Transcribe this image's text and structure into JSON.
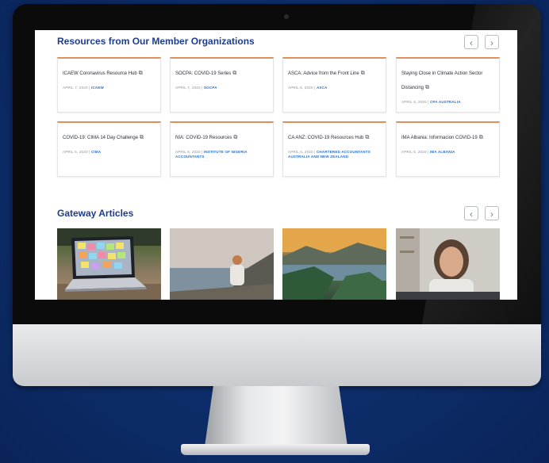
{
  "resources": {
    "title": "Resources from Our Member Organizations",
    "prev_label": "‹",
    "next_label": "›",
    "cards": [
      {
        "title": "ICAEW Coronavirus Resource Hub",
        "date": "APRIL 7, 2020",
        "org": "ICAEW"
      },
      {
        "title": "SOCPA: COVID-19 Series",
        "date": "APRIL 7, 2020",
        "org": "SOCPA"
      },
      {
        "title": "ASCA: Advice from the Front Line",
        "date": "APRIL 6, 2020",
        "org": "ASCA"
      },
      {
        "title": "Staying Close in Climate Action Sector Distancing",
        "date": "APRIL 6, 2020",
        "org": "CPA AUSTRALIA"
      },
      {
        "title": "COVID-19: CIMA 14 Day Challenge",
        "date": "APRIL 6, 2020",
        "org": "CIMA"
      },
      {
        "title": "NIA: COVID-19 Resources",
        "date": "APRIL 6, 2020",
        "org": "INSTITUTE OF NIGERIA ACCOUNTANTS"
      },
      {
        "title": "CA ANZ: COVID-19 Resources Hub",
        "date": "APRIL 6, 2020",
        "org": "CHARTERED ACCOUNTANTS AUSTRALIA AND NEW ZEALAND"
      },
      {
        "title": "IMA Albania: Informacion COVID-19",
        "date": "APRIL 6, 2020",
        "org": "IMA ALBANIA"
      }
    ]
  },
  "gateway": {
    "title": "Gateway Articles",
    "prev_label": "‹",
    "next_label": "›"
  },
  "icons": {
    "external_link": "external-link-icon",
    "camera": "camera-icon"
  },
  "colors": {
    "background": "#0d2d6b",
    "heading": "#1c3c8c",
    "card_accent": "#e08f5e",
    "link": "#2a6fc4"
  }
}
